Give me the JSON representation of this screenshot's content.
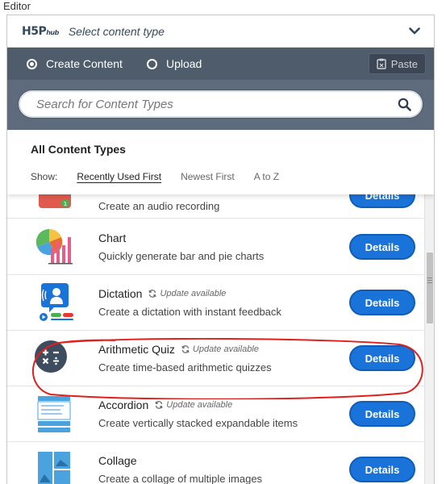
{
  "page": {
    "label": "Editor"
  },
  "hub": {
    "logo": {
      "main": "H5P",
      "sub": "hub"
    },
    "select_label": "Select content type",
    "chevron_icon": "chevron-down-icon"
  },
  "tabs": {
    "create": "Create Content",
    "upload": "Upload",
    "selected": "create",
    "paste": "Paste",
    "paste_icon": "clipboard-icon"
  },
  "search": {
    "placeholder": "Search for Content Types",
    "value": "",
    "icon": "search-icon"
  },
  "list_header": {
    "title": "All Content Types",
    "show_label": "Show:",
    "sort_options": [
      "Recently Used First",
      "Newest First",
      "A to Z"
    ],
    "active_sort": "Recently Used First"
  },
  "items": [
    {
      "name": "",
      "desc": "Create an audio recording",
      "update": "",
      "icon": "audio-recorder-icon",
      "button": "Details"
    },
    {
      "name": "Chart",
      "desc": "Quickly generate bar and pie charts",
      "update": "",
      "icon": "chart-icon",
      "button": "Details"
    },
    {
      "name": "Dictation",
      "desc": "Create a dictation with instant feedback",
      "update": "Update available",
      "icon": "dictation-icon",
      "button": "Details"
    },
    {
      "name": "Arithmetic Quiz",
      "desc": "Create time-based arithmetic quizzes",
      "update": "Update available",
      "icon": "arithmetic-quiz-icon",
      "button": "Details"
    },
    {
      "name": "Accordion",
      "desc": "Create vertically stacked expandable items",
      "update": "Update available",
      "icon": "accordion-icon",
      "button": "Details"
    },
    {
      "name": "Collage",
      "desc": "Create a collage of multiple images",
      "update": "",
      "icon": "collage-icon",
      "button": "Details"
    }
  ],
  "colors": {
    "accent": "#1a73d9",
    "header_dark": "#4e5c6c",
    "search_bg": "#5d6b7c",
    "annotation": "#e0201c"
  }
}
